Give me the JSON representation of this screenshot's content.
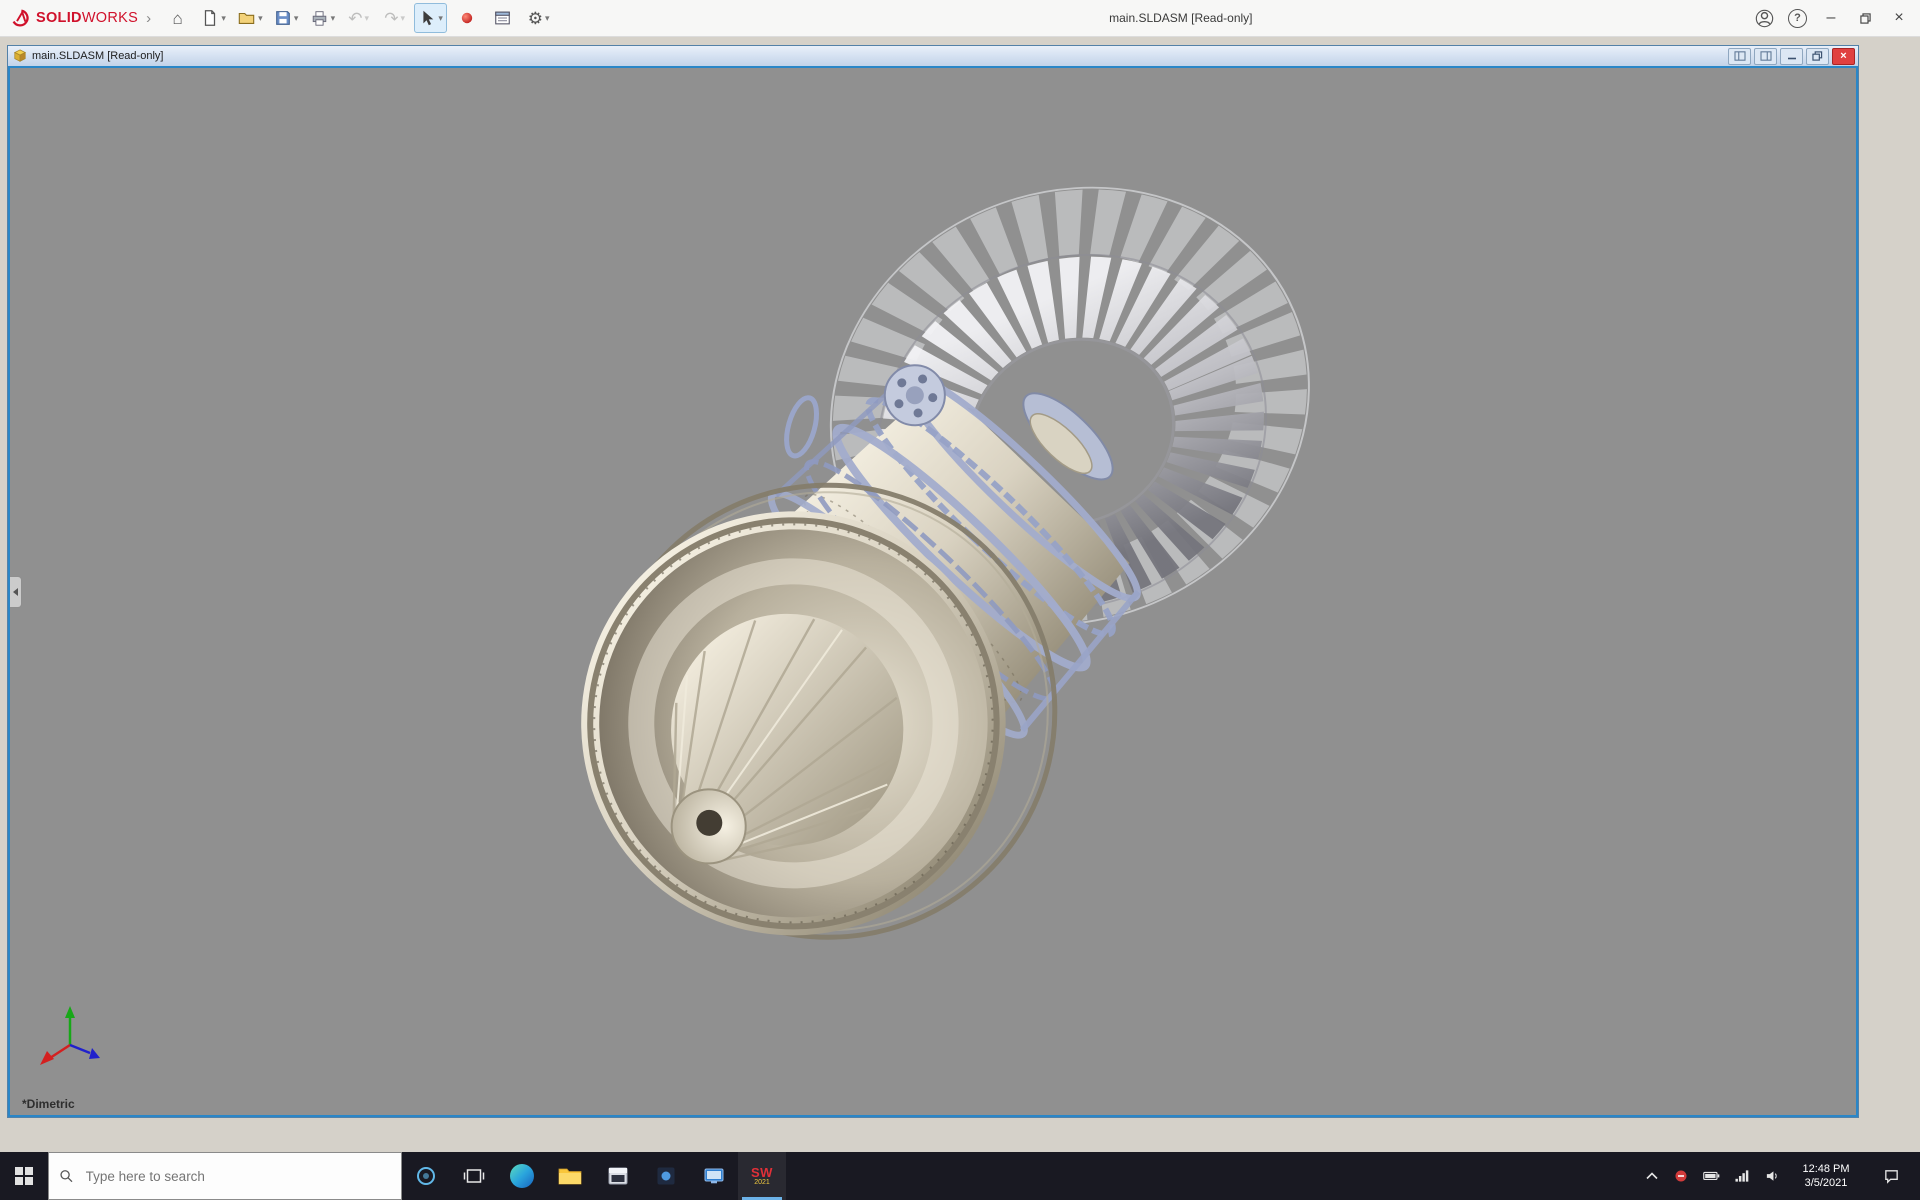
{
  "app": {
    "title": "main.SLDASM [Read-only]",
    "brand": {
      "solid": "SOLID",
      "works": "WORKS"
    }
  },
  "glyphs": {
    "home": "⌂",
    "undo": "↶",
    "redo": "↷",
    "gear": "⚙",
    "caret": "▾",
    "expand": "›",
    "minimize": "–",
    "close": "×",
    "help": "?"
  },
  "toolbar": {
    "buttons": [
      {
        "name": "home"
      },
      {
        "name": "new-document"
      },
      {
        "name": "open"
      },
      {
        "name": "save"
      },
      {
        "name": "print"
      },
      {
        "name": "undo",
        "disabled": true
      },
      {
        "name": "redo",
        "disabled": true
      },
      {
        "name": "select",
        "active": true
      },
      {
        "name": "mouse-gesture"
      },
      {
        "name": "task-pane"
      },
      {
        "name": "options"
      }
    ]
  },
  "child_window": {
    "title": "main.SLDASM [Read-only]"
  },
  "viewport": {
    "view_label": "*Dimetric",
    "background": "#909090"
  },
  "model": {
    "name": "jet-engine-assembly",
    "body_color": "#d8d1c0",
    "frame_color": "#a2accc",
    "blade_color": "#c2c2c8"
  },
  "taskbar": {
    "search_placeholder": "Type here to search",
    "time": "12:48 PM",
    "date": "3/5/2021",
    "solidworks": {
      "letters": "SW",
      "badge": "2021"
    }
  },
  "colors": {
    "accent_blue": "#2a86c7",
    "brand_red": "#d0112b",
    "taskbar_bg": "#191922",
    "workspace_bg": "#d5d1c9",
    "appbar_bg": "#f7f7f6"
  }
}
